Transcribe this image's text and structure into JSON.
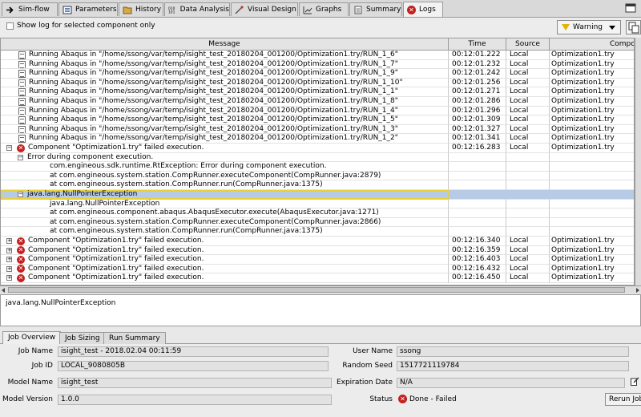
{
  "tabs": [
    {
      "label": "Sim-flow",
      "icon": "arrow-icon"
    },
    {
      "label": "Parameters",
      "icon": "parameters-icon"
    },
    {
      "label": "History",
      "icon": "history-icon"
    },
    {
      "label": "Data Analysis",
      "icon": "data-analysis-icon"
    },
    {
      "label": "Visual Design",
      "icon": "visual-design-icon"
    },
    {
      "label": "Graphs",
      "icon": "graphs-icon"
    },
    {
      "label": "Summary",
      "icon": "summary-icon"
    },
    {
      "label": "Logs",
      "icon": "error-icon",
      "active": true
    }
  ],
  "options": {
    "show_log_label": "Show log for selected component only",
    "show_log_checked": false,
    "level": "Warning"
  },
  "table": {
    "columns": [
      "Message",
      "Time",
      "Source",
      "Component"
    ],
    "rows": [
      {
        "indent": 0,
        "expander": "",
        "icon": "doc",
        "msg": "Running Abaqus in \"/home/ssong/var/temp/isight_test_20180204_001200/Optimization1.try/RUN_1_6\"",
        "time": "00:12:01.222",
        "source": "Local",
        "component": "Optimization1.try"
      },
      {
        "indent": 0,
        "expander": "",
        "icon": "doc",
        "msg": "Running Abaqus in \"/home/ssong/var/temp/isight_test_20180204_001200/Optimization1.try/RUN_1_7\"",
        "time": "00:12:01.232",
        "source": "Local",
        "component": "Optimization1.try"
      },
      {
        "indent": 0,
        "expander": "",
        "icon": "doc",
        "msg": "Running Abaqus in \"/home/ssong/var/temp/isight_test_20180204_001200/Optimization1.try/RUN_1_9\"",
        "time": "00:12:01.242",
        "source": "Local",
        "component": "Optimization1.try"
      },
      {
        "indent": 0,
        "expander": "",
        "icon": "doc",
        "msg": "Running Abaqus in \"/home/ssong/var/temp/isight_test_20180204_001200/Optimization1.try/RUN_1_10\"",
        "time": "00:12:01.256",
        "source": "Local",
        "component": "Optimization1.try"
      },
      {
        "indent": 0,
        "expander": "",
        "icon": "doc",
        "msg": "Running Abaqus in \"/home/ssong/var/temp/isight_test_20180204_001200/Optimization1.try/RUN_1_1\"",
        "time": "00:12:01.271",
        "source": "Local",
        "component": "Optimization1.try"
      },
      {
        "indent": 0,
        "expander": "",
        "icon": "doc",
        "msg": "Running Abaqus in \"/home/ssong/var/temp/isight_test_20180204_001200/Optimization1.try/RUN_1_8\"",
        "time": "00:12:01.286",
        "source": "Local",
        "component": "Optimization1.try"
      },
      {
        "indent": 0,
        "expander": "",
        "icon": "doc",
        "msg": "Running Abaqus in \"/home/ssong/var/temp/isight_test_20180204_001200/Optimization1.try/RUN_1_4\"",
        "time": "00:12:01.296",
        "source": "Local",
        "component": "Optimization1.try"
      },
      {
        "indent": 0,
        "expander": "",
        "icon": "doc",
        "msg": "Running Abaqus in \"/home/ssong/var/temp/isight_test_20180204_001200/Optimization1.try/RUN_1_5\"",
        "time": "00:12:01.309",
        "source": "Local",
        "component": "Optimization1.try"
      },
      {
        "indent": 0,
        "expander": "",
        "icon": "doc",
        "msg": "Running Abaqus in \"/home/ssong/var/temp/isight_test_20180204_001200/Optimization1.try/RUN_1_3\"",
        "time": "00:12:01.327",
        "source": "Local",
        "component": "Optimization1.try"
      },
      {
        "indent": 0,
        "expander": "",
        "icon": "doc",
        "msg": "Running Abaqus in \"/home/ssong/var/temp/isight_test_20180204_001200/Optimization1.try/RUN_1_2\"",
        "time": "00:12:01.341",
        "source": "Local",
        "component": "Optimization1.try"
      },
      {
        "indent": 0,
        "expander": "−",
        "icon": "error",
        "msg": "Component \"Optimization1.try\" failed execution.",
        "time": "00:12:16.283",
        "source": "Local",
        "component": "Optimization1.try"
      },
      {
        "indent": 1,
        "expander": "−",
        "icon": "",
        "msg": "Error during component execution.",
        "time": "",
        "source": "",
        "component": ""
      },
      {
        "indent": 3,
        "expander": "",
        "icon": "",
        "msg": "com.engineous.sdk.runtime.RtException: Error during component execution.",
        "time": "",
        "source": "",
        "component": ""
      },
      {
        "indent": 3,
        "expander": "",
        "icon": "",
        "msg": "at com.engineous.system.station.CompRunner.executeComponent(CompRunner.java:2879)",
        "time": "",
        "source": "",
        "component": ""
      },
      {
        "indent": 3,
        "expander": "",
        "icon": "",
        "msg": "at com.engineous.system.station.CompRunner.run(CompRunner.java:1375)",
        "time": "",
        "source": "",
        "component": ""
      },
      {
        "indent": 1,
        "expander": "−",
        "icon": "",
        "msg": "java.lang.NullPointerException",
        "time": "",
        "source": "",
        "component": "",
        "selected": true
      },
      {
        "indent": 3,
        "expander": "",
        "icon": "",
        "msg": "java.lang.NullPointerException",
        "time": "",
        "source": "",
        "component": ""
      },
      {
        "indent": 3,
        "expander": "",
        "icon": "",
        "msg": "at com.engineous.component.abaqus.AbaqusExecutor.execute(AbaqusExecutor.java:1271)",
        "time": "",
        "source": "",
        "component": ""
      },
      {
        "indent": 3,
        "expander": "",
        "icon": "",
        "msg": "at com.engineous.system.station.CompRunner.executeComponent(CompRunner.java:2866)",
        "time": "",
        "source": "",
        "component": ""
      },
      {
        "indent": 3,
        "expander": "",
        "icon": "",
        "msg": "at com.engineous.system.station.CompRunner.run(CompRunner.java:1375)",
        "time": "",
        "source": "",
        "component": ""
      },
      {
        "indent": 0,
        "expander": "+",
        "icon": "error",
        "msg": "Component \"Optimization1.try\" failed execution.",
        "time": "00:12:16.340",
        "source": "Local",
        "component": "Optimization1.try"
      },
      {
        "indent": 0,
        "expander": "+",
        "icon": "error",
        "msg": "Component \"Optimization1.try\" failed execution.",
        "time": "00:12:16.359",
        "source": "Local",
        "component": "Optimization1.try"
      },
      {
        "indent": 0,
        "expander": "+",
        "icon": "error",
        "msg": "Component \"Optimization1.try\" failed execution.",
        "time": "00:12:16.403",
        "source": "Local",
        "component": "Optimization1.try"
      },
      {
        "indent": 0,
        "expander": "+",
        "icon": "error",
        "msg": "Component \"Optimization1.try\" failed execution.",
        "time": "00:12:16.432",
        "source": "Local",
        "component": "Optimization1.try"
      },
      {
        "indent": 0,
        "expander": "+",
        "icon": "error",
        "msg": "Component \"Optimization1.try\" failed execution.",
        "time": "00:12:16.450",
        "source": "Local",
        "component": "Optimization1.try"
      }
    ]
  },
  "detail_text": "java.lang.NullPointerException",
  "bottom_tabs": [
    "Job Overview",
    "Job Sizing",
    "Run Summary"
  ],
  "job": {
    "job_name_label": "Job Name",
    "job_name": "isight_test - 2018.02.04 00:11:59",
    "job_id_label": "Job ID",
    "job_id": "LOCAL_9080805B",
    "model_name_label": "Model Name",
    "model_name": "isight_test",
    "model_version_label": "Model Version",
    "model_version": "1.0.0",
    "user_name_label": "User Name",
    "user_name": "ssong",
    "random_seed_label": "Random Seed",
    "random_seed": "1517721119784",
    "expiration_label": "Expiration Date",
    "expiration": "N/A",
    "status_label": "Status",
    "status": "Done - Failed",
    "rerun_label": "Rerun Job"
  },
  "colors": {
    "error": "#c41e1e",
    "selection": "#b8cbe6",
    "selection_border": "#e6d23c",
    "warning": "#e0b400"
  }
}
